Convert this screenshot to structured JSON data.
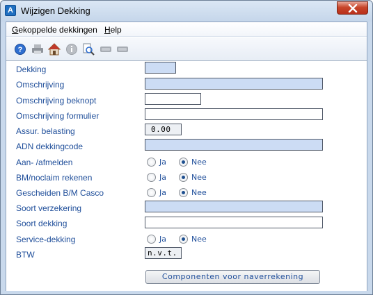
{
  "window": {
    "title": "Wijzigen Dekking",
    "app_icon_letter": "A"
  },
  "menu": {
    "items": [
      {
        "label": "Gekoppelde dekkingen"
      },
      {
        "label": "Help"
      }
    ]
  },
  "toolbar": {
    "icons": [
      "help-icon",
      "print-icon",
      "home-icon",
      "info-icon",
      "search-document-icon",
      "record-icon",
      "record-icon-2"
    ]
  },
  "form": {
    "dekking": {
      "label": "Dekking",
      "value": ""
    },
    "omschrijving": {
      "label": "Omschrijving",
      "value": ""
    },
    "omschrijving_beknopt": {
      "label": "Omschrijving beknopt",
      "value": ""
    },
    "omschrijving_formulier": {
      "label": "Omschrijving formulier",
      "value": ""
    },
    "assur_belasting": {
      "label": "Assur. belasting",
      "value": "0.00"
    },
    "adn_dekkingcode": {
      "label": "ADN dekkingcode",
      "value": ""
    },
    "aan_afmelden": {
      "label": "Aan- /afmelden",
      "options": [
        "Ja",
        "Nee"
      ],
      "selected": "Nee"
    },
    "bm_noclaim": {
      "label": "BM/noclaim rekenen",
      "options": [
        "Ja",
        "Nee"
      ],
      "selected": "Nee"
    },
    "gescheiden_bm": {
      "label": "Gescheiden B/M Casco",
      "options": [
        "Ja",
        "Nee"
      ],
      "selected": "Nee"
    },
    "soort_verzekering": {
      "label": "Soort verzekering",
      "value": ""
    },
    "soort_dekking": {
      "label": "Soort dekking",
      "value": ""
    },
    "service_dekking": {
      "label": "Service-dekking",
      "options": [
        "Ja",
        "Nee"
      ],
      "selected": "Nee"
    },
    "btw": {
      "label": "BTW",
      "value": "n.v.t."
    }
  },
  "buttons": {
    "componenten": "Componenten voor naverrekening"
  },
  "colors": {
    "label_text": "#1f4e9a",
    "field_blue": "#ccdcf4",
    "close_button": "#c7452a"
  }
}
